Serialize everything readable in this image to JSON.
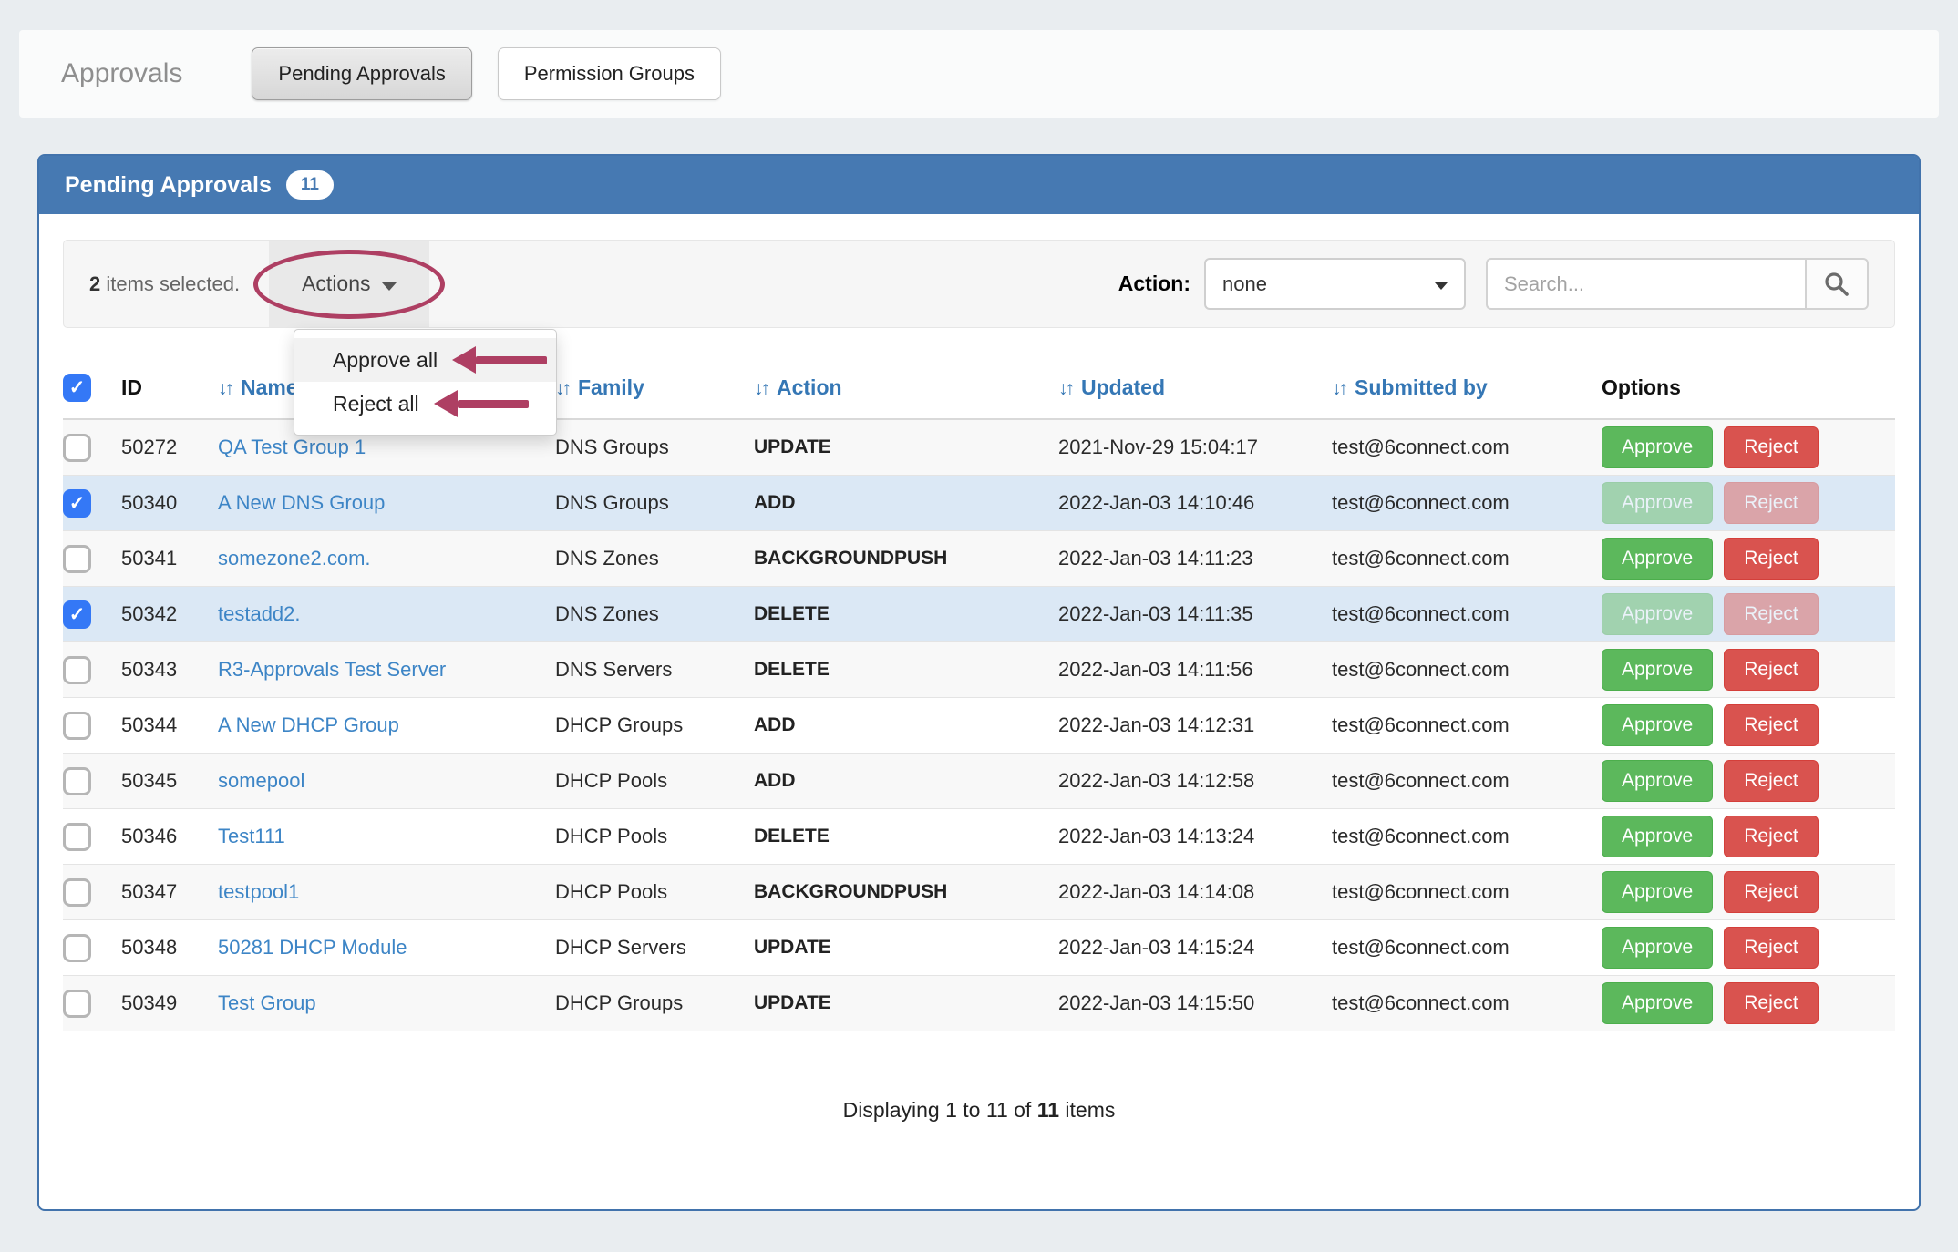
{
  "header": {
    "title": "Approvals",
    "tabs": [
      {
        "label": "Pending Approvals",
        "active": true
      },
      {
        "label": "Permission Groups",
        "active": false
      }
    ]
  },
  "panel": {
    "title": "Pending Approvals",
    "badge": "11"
  },
  "toolbar": {
    "selected_count": "2",
    "selected_suffix": " items selected.",
    "actions_label": "Actions",
    "action_filter_label": "Action:",
    "action_filter_value": "none",
    "search_placeholder": "Search...",
    "search_icon": "magnifier-icon"
  },
  "actions_menu": {
    "items": [
      {
        "label": "Approve all",
        "highlighted": true,
        "annotated": true
      },
      {
        "label": "Reject all",
        "highlighted": false,
        "annotated": true
      }
    ]
  },
  "annotations": {
    "color": "#ae3f63",
    "circled_element": "Actions",
    "arrows_point_to": [
      "Approve all",
      "Reject all"
    ]
  },
  "table": {
    "select_all_checked": true,
    "columns": [
      {
        "label": "ID",
        "sortable": false
      },
      {
        "label": "Name",
        "sortable": true
      },
      {
        "label": "Family",
        "sortable": true
      },
      {
        "label": "Action",
        "sortable": true
      },
      {
        "label": "Updated",
        "sortable": true
      },
      {
        "label": "Submitted by",
        "sortable": true
      },
      {
        "label": "Options",
        "sortable": false
      }
    ],
    "row_buttons": {
      "approve": "Approve",
      "reject": "Reject"
    },
    "rows": [
      {
        "checked": false,
        "id": "50272",
        "name": "QA Test Group 1",
        "family": "DNS Groups",
        "action": "UPDATE",
        "updated": "2021-Nov-29 15:04:17",
        "submitted_by": "test@6connect.com"
      },
      {
        "checked": true,
        "id": "50340",
        "name": "A New DNS Group",
        "family": "DNS Groups",
        "action": "ADD",
        "updated": "2022-Jan-03 14:10:46",
        "submitted_by": "test@6connect.com"
      },
      {
        "checked": false,
        "id": "50341",
        "name": "somezone2.com.",
        "family": "DNS Zones",
        "action": "BACKGROUNDPUSH",
        "updated": "2022-Jan-03 14:11:23",
        "submitted_by": "test@6connect.com"
      },
      {
        "checked": true,
        "id": "50342",
        "name": "testadd2.",
        "family": "DNS Zones",
        "action": "DELETE",
        "updated": "2022-Jan-03 14:11:35",
        "submitted_by": "test@6connect.com"
      },
      {
        "checked": false,
        "id": "50343",
        "name": "R3-Approvals Test Server",
        "family": "DNS Servers",
        "action": "DELETE",
        "updated": "2022-Jan-03 14:11:56",
        "submitted_by": "test@6connect.com"
      },
      {
        "checked": false,
        "id": "50344",
        "name": "A New DHCP Group",
        "family": "DHCP Groups",
        "action": "ADD",
        "updated": "2022-Jan-03 14:12:31",
        "submitted_by": "test@6connect.com"
      },
      {
        "checked": false,
        "id": "50345",
        "name": "somepool",
        "family": "DHCP Pools",
        "action": "ADD",
        "updated": "2022-Jan-03 14:12:58",
        "submitted_by": "test@6connect.com"
      },
      {
        "checked": false,
        "id": "50346",
        "name": "Test111",
        "family": "DHCP Pools",
        "action": "DELETE",
        "updated": "2022-Jan-03 14:13:24",
        "submitted_by": "test@6connect.com"
      },
      {
        "checked": false,
        "id": "50347",
        "name": "testpool1",
        "family": "DHCP Pools",
        "action": "BACKGROUNDPUSH",
        "updated": "2022-Jan-03 14:14:08",
        "submitted_by": "test@6connect.com"
      },
      {
        "checked": false,
        "id": "50348",
        "name": "50281 DHCP Module",
        "family": "DHCP Servers",
        "action": "UPDATE",
        "updated": "2022-Jan-03 14:15:24",
        "submitted_by": "test@6connect.com"
      },
      {
        "checked": false,
        "id": "50349",
        "name": "Test Group",
        "family": "DHCP Groups",
        "action": "UPDATE",
        "updated": "2022-Jan-03 14:15:50",
        "submitted_by": "test@6connect.com"
      }
    ],
    "footer": {
      "prefix": "Displaying 1 to 11 of ",
      "bold": "11",
      "suffix": " items"
    }
  },
  "colors": {
    "page_bg": "#e9edf0",
    "panel_header": "#4679b2",
    "panel_border": "#4273ac",
    "selected_row": "#dbe8f5",
    "stripe_row": "#f8f8f8",
    "link": "#3d85c6",
    "sortable_header": "#3577b5",
    "approve_green": "#5cb85c",
    "reject_red": "#d9534f",
    "checkbox_blue": "#3478f6",
    "annotation": "#ae3f63"
  }
}
